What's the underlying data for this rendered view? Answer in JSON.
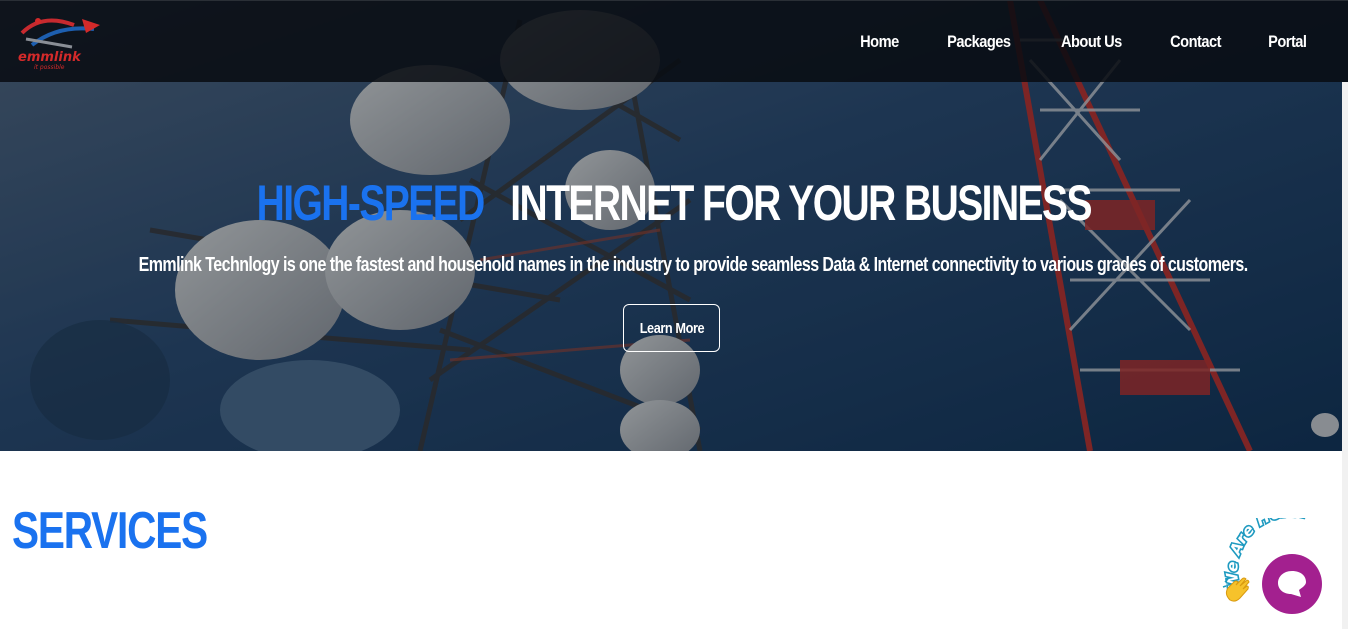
{
  "brand": {
    "logo_text": "emmlink",
    "logo_tagline": "it possible",
    "colors": {
      "accent_blue": "#1a72ef",
      "logo_red": "#d32a2a",
      "chat_purple": "#a3208f"
    }
  },
  "nav": {
    "items": [
      {
        "label": "Home"
      },
      {
        "label": "Packages"
      },
      {
        "label": "About Us"
      },
      {
        "label": "Contact"
      },
      {
        "label": "Portal"
      }
    ]
  },
  "hero": {
    "title_highlight": "HIGH-SPEED",
    "title_rest": "INTERNET FOR YOUR BUSINESS",
    "subtitle_brand": "Emmlink Technlogy",
    "subtitle_rest": " is one the fastest and household names in the industry to provide seamless Data & Internet connectivity to various grades of customers.",
    "cta_label": "Learn More"
  },
  "services": {
    "title": "SERVICES"
  },
  "chat": {
    "badge_text": "We Are Here!",
    "icons": [
      "waving-hand-icon",
      "chat-bubble-icon"
    ]
  }
}
